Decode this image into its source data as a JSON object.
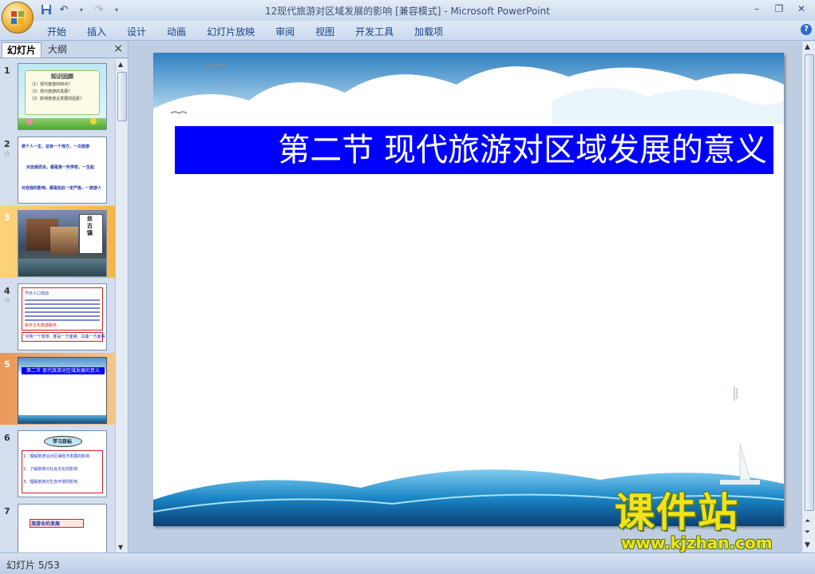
{
  "window": {
    "title": "12现代旅游对区域发展的影响 [兼容模式] - Microsoft PowerPoint",
    "controls": [
      "minimize",
      "restore",
      "close"
    ]
  },
  "qat": {
    "icons": [
      "save-icon",
      "undo-icon",
      "redo-icon",
      "customize-icon"
    ]
  },
  "ribbon": {
    "tabs": [
      "开始",
      "插入",
      "设计",
      "动画",
      "幻灯片放映",
      "审阅",
      "视图",
      "开发工具",
      "加载项"
    ],
    "help": "?"
  },
  "left_pane": {
    "tabs": [
      "幻灯片",
      "大纲"
    ],
    "close": "×",
    "slides": [
      {
        "num": "1",
        "title": "知识回顾",
        "lines": [
          "（1）现代旅游的特点？",
          "（2）现代旅游的发展？",
          "（3）影响旅游业发展的因素？"
        ]
      },
      {
        "num": "2",
        "lines": [
          "若个人一生，总有一个地方，一次旅游",
          "对自我而言，都是第一所学校，一生起",
          "对自我的影响，都是如此一定严格，一旅游人"
        ]
      },
      {
        "num": "3",
        "caption": "丝古镇"
      },
      {
        "num": "4",
        "lines": [
          "节日人口流动",
          "如今文化旅游服务",
          "“对我一个旅游，都是一方面第，具备一方面等"
        ]
      },
      {
        "num": "5",
        "title": "第二节 现代旅游对区域发展的意义"
      },
      {
        "num": "6",
        "title": "学习目标",
        "lines": [
          "1、理解旅游业对区域经济发展的影响",
          "2、了解旅游对社会文化的影响",
          "3、理解旅游对生态环境的影响"
        ]
      },
      {
        "num": "7",
        "title": "旅游业的发展"
      }
    ],
    "selected": "5"
  },
  "slide": {
    "heading": "第二节  现代旅游对区域发展的意义"
  },
  "status": {
    "text": "幻灯片 5/53"
  },
  "watermark": {
    "title": "课件站",
    "url": "www.kjzhan.com"
  }
}
